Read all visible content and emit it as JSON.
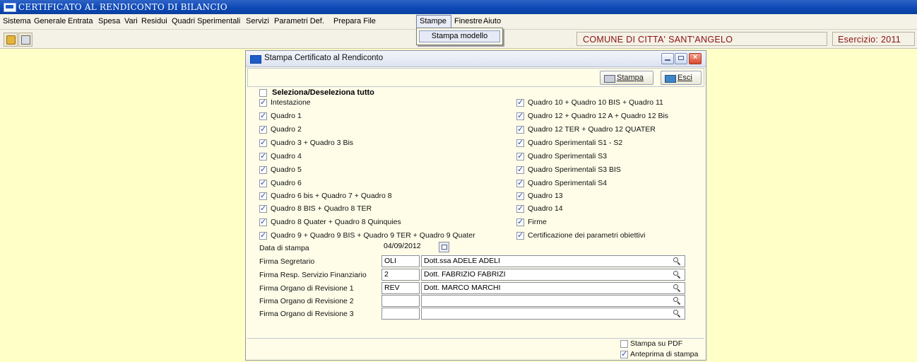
{
  "app": {
    "title": "CERTIFICATO AL RENDICONTO DI BILANCIO"
  },
  "menu": [
    "Sistema",
    "Generale",
    "Entrata",
    "Spesa",
    "Vari",
    "Residui",
    "Quadri Sperimentali",
    "Servizi",
    "Parametri Def.",
    "Prepara File",
    "Stampe",
    "Finestre",
    "Aiuto"
  ],
  "dropdown": {
    "item": "Stampa modello"
  },
  "toolbar": {
    "lock_icon": "lock-icon",
    "print_icon": "printer-icon"
  },
  "header": {
    "comune": "COMUNE DI CITTA' SANT'ANGELO",
    "esercizio": "Esercizio: 2011"
  },
  "dialog": {
    "title": "Stampa Certificato al Rendiconto",
    "stampa_label": "Stampa",
    "esci_label": "Esci",
    "select_all_label": "Seleziona/Deseleziona tutto",
    "left_items": [
      {
        "label": "Intestazione",
        "checked": true
      },
      {
        "label": "Quadro 1",
        "checked": true
      },
      {
        "label": "Quadro 2",
        "checked": true
      },
      {
        "label": "Quadro 3 + Quadro 3 Bis",
        "checked": true
      },
      {
        "label": "Quadro 4",
        "checked": true
      },
      {
        "label": "Quadro 5",
        "checked": true
      },
      {
        "label": "Quadro 6",
        "checked": true
      },
      {
        "label": "Quadro 6 bis + Quadro 7 + Quadro 8",
        "checked": true
      },
      {
        "label": "Quadro 8 BIS + Quadro 8 TER",
        "checked": true
      },
      {
        "label": "Quadro 8 Quater + Quadro 8 Quinquies",
        "checked": true
      },
      {
        "label": "Quadro 9 + Quadro 9 BIS + Quadro 9 TER + Quadro 9 Quater",
        "checked": true
      }
    ],
    "right_items": [
      {
        "label": "Quadro 10 + Quadro 10 BIS + Quadro 11",
        "checked": true
      },
      {
        "label": "Quadro 12 + Quadro 12 A + Quadro 12 Bis",
        "checked": true
      },
      {
        "label": "Quadro 12 TER + Quadro 12 QUATER",
        "checked": true
      },
      {
        "label": "Quadro Sperimentali S1 - S2",
        "checked": true
      },
      {
        "label": "Quadro Sperimentali S3",
        "checked": true
      },
      {
        "label": "Quadro Sperimentali S3 BIS",
        "checked": true
      },
      {
        "label": "Quadro Sperimentali S4",
        "checked": true
      },
      {
        "label": "Quadro 13",
        "checked": true
      },
      {
        "label": "Quadro 14",
        "checked": true
      },
      {
        "label": "Firme",
        "checked": true
      },
      {
        "label": "Certificazione dei parametri obiettivi",
        "checked": true
      }
    ],
    "data_stampa_label": "Data di stampa",
    "data_stampa_value": "04/09/2012",
    "firme": [
      {
        "label": "Firma Segretario",
        "code": "OLI",
        "name": "Dott.ssa ADELE ADELI"
      },
      {
        "label": "Firma Resp. Servizio Finanziario",
        "code": "2",
        "name": "Dott. FABRIZIO FABRIZI"
      },
      {
        "label": "Firma Organo di Revisione 1",
        "code": "REV",
        "name": "Dott. MARCO MARCHI"
      },
      {
        "label": "Firma Organo di Revisione 2",
        "code": "",
        "name": ""
      },
      {
        "label": "Firma Organo di Revisione 3",
        "code": "",
        "name": ""
      }
    ],
    "stampa_pdf": {
      "label": "Stampa su PDF",
      "checked": false
    },
    "anteprima": {
      "label": "Anteprima di stampa",
      "checked": true
    }
  }
}
